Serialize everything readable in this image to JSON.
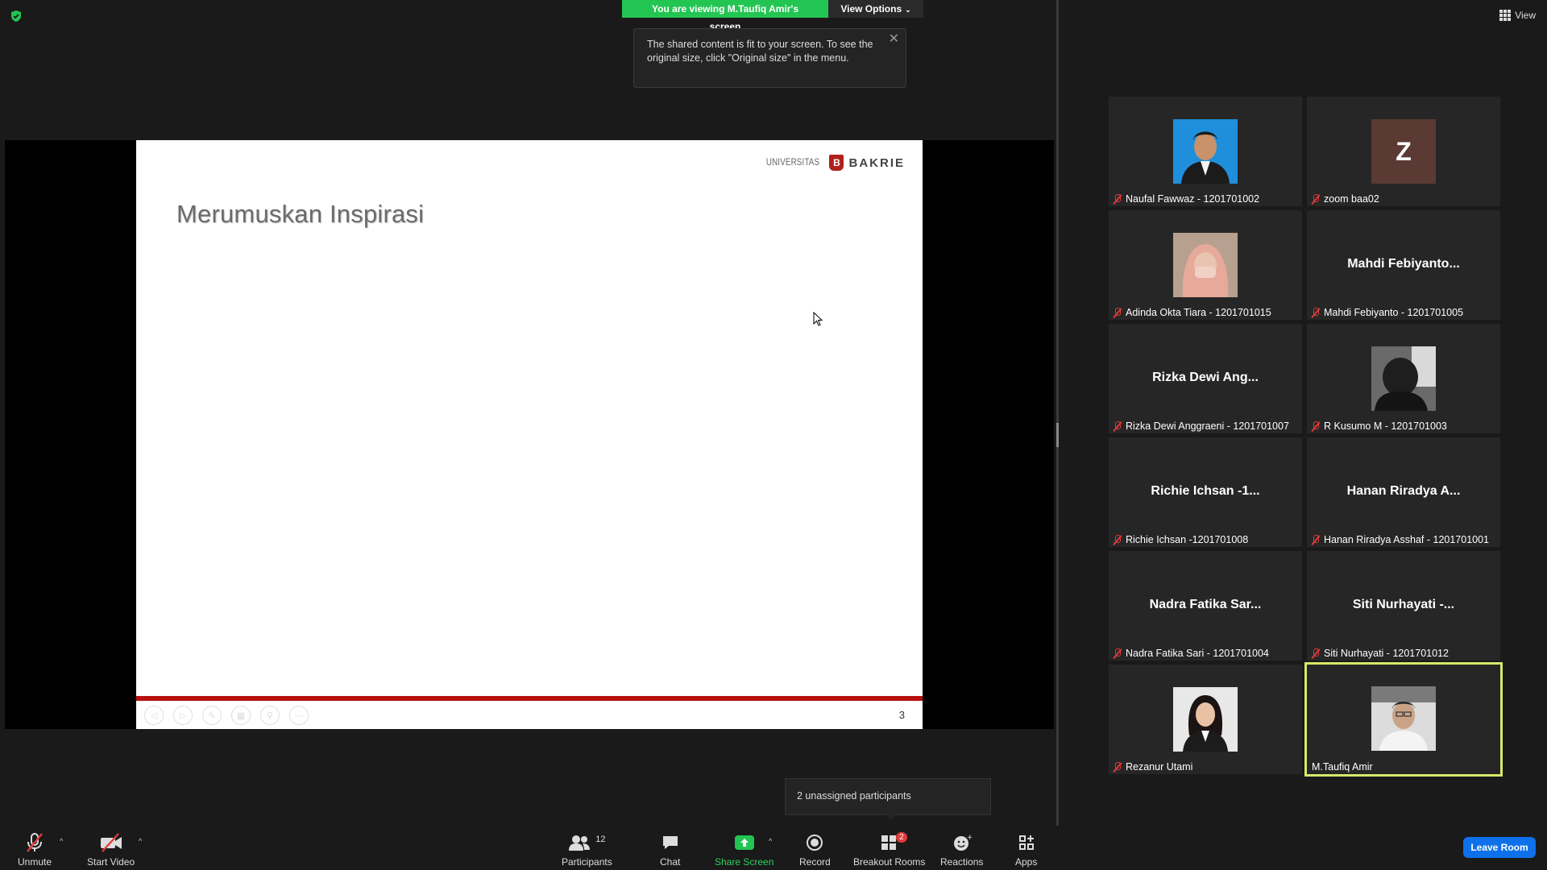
{
  "banner": {
    "viewing_text": "You are viewing M.Taufiq Amir's screen",
    "view_options": "View Options",
    "tooltip_text": "The shared content is fit to your screen. To see the original size, click \"Original size\" in the menu."
  },
  "slide": {
    "title": "Merumuskan Inspirasi",
    "logo_left": "UNIVERSITAS",
    "logo_badge": "B",
    "logo_right": "BAKRIE",
    "page_number": "3",
    "accent_color": "#b80f0f"
  },
  "gallery": {
    "view_label": "View",
    "tiles": [
      {
        "label": "Naufal Fawwaz - 1201701002",
        "display": "photo",
        "muted": true
      },
      {
        "label": "zoom baa02",
        "display": "letter",
        "letter": "Z",
        "muted": true
      },
      {
        "label": "Adinda Okta Tiara - 1201701015",
        "display": "photo",
        "muted": true
      },
      {
        "label": "Mahdi Febiyanto - 1201701005",
        "display": "name",
        "big_name": "Mahdi  Febiyanto...",
        "muted": true
      },
      {
        "label": "Rizka Dewi Anggraeni - 1201701007",
        "display": "name",
        "big_name": "Rizka Dewi Ang...",
        "muted": true
      },
      {
        "label": "R Kusumo M - 1201701003",
        "display": "photo",
        "muted": true
      },
      {
        "label": "Richie Ichsan -1201701008",
        "display": "name",
        "big_name": "Richie Ichsan -1...",
        "muted": true
      },
      {
        "label": "Hanan Riradya Asshaf - 1201701001",
        "display": "name",
        "big_name": "Hanan Riradya A...",
        "muted": true
      },
      {
        "label": "Nadra Fatika Sari - 1201701004",
        "display": "name",
        "big_name": "Nadra Fatika Sar...",
        "muted": true
      },
      {
        "label": "Siti Nurhayati - 1201701012",
        "display": "name",
        "big_name": "Siti Nurhayati -...",
        "muted": true
      },
      {
        "label": "Rezanur Utami",
        "display": "photo",
        "muted": true
      },
      {
        "label": "M.Taufiq Amir",
        "display": "photo",
        "muted": false,
        "active": true
      }
    ]
  },
  "toast": {
    "text": "2 unassigned participants"
  },
  "toolbar": {
    "unmute": "Unmute",
    "start_video": "Start Video",
    "participants": "Participants",
    "participants_count": "12",
    "chat": "Chat",
    "share_screen": "Share Screen",
    "record": "Record",
    "breakout_rooms": "Breakout Rooms",
    "breakout_badge": "2",
    "reactions": "Reactions",
    "apps": "Apps",
    "leave_room": "Leave Room",
    "share_color": "#23c552",
    "leave_color": "#0e71eb"
  }
}
